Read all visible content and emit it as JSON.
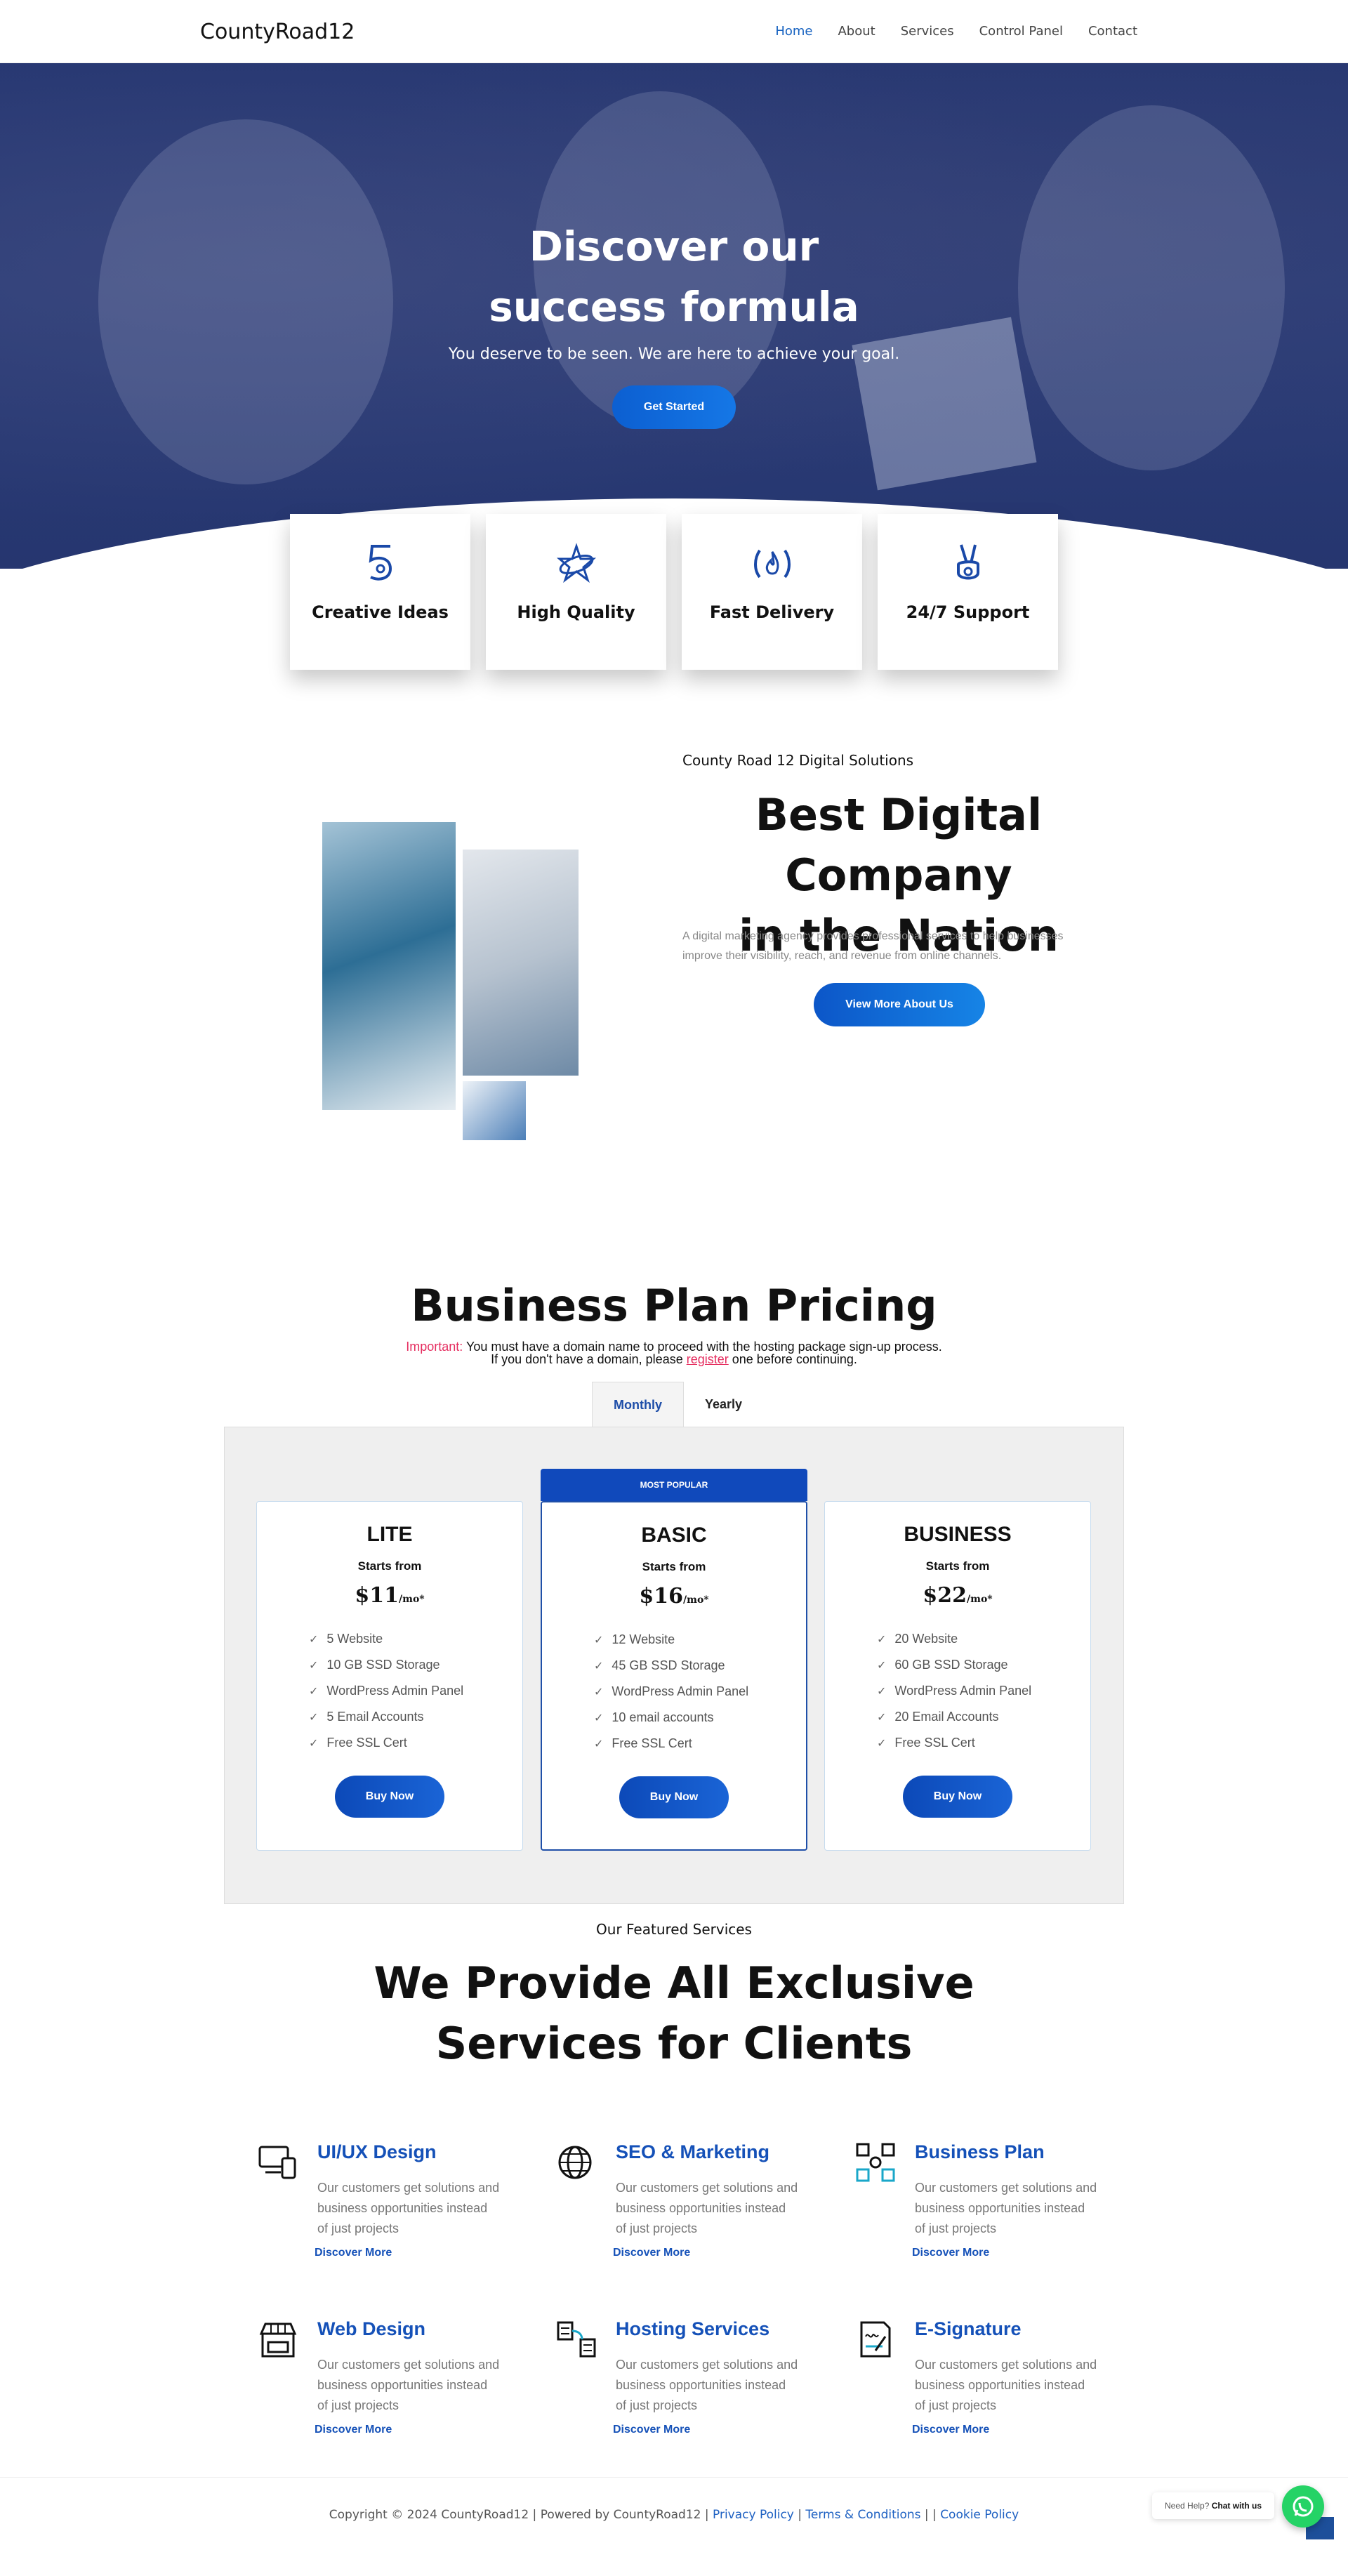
{
  "nav": {
    "logo": "CountyRoad12",
    "items": [
      "Home",
      "About",
      "Services",
      "Control Panel",
      "Contact"
    ],
    "active": "Home"
  },
  "hero": {
    "title_line1": "Discover our",
    "title_line2": "success formula",
    "subtitle": "You deserve to be seen. We are here to achieve your goal.",
    "cta": "Get Started"
  },
  "features": [
    {
      "label": "Creative Ideas",
      "icon": "number-5-icon"
    },
    {
      "label": "High Quality",
      "icon": "star-orbit-icon"
    },
    {
      "label": "Fast Delivery",
      "icon": "flame-icon"
    },
    {
      "label": "24/7 Support",
      "icon": "victory-hand-icon"
    }
  ],
  "about": {
    "eyebrow": "County Road 12 Digital Solutions",
    "title_line1": "Best Digital Company",
    "title_line2": "in the Nation",
    "text": "A digital marketing agency provides professional services to help businesses improve their visibility, reach, and revenue from online channels.",
    "cta": "View More About Us"
  },
  "pricing": {
    "title": "Business Plan Pricing",
    "note_important": "Important:",
    "note_rest": " You must have a domain name to proceed with the hosting package sign-up process.",
    "note_line2_a": "If you don't have a domain, please ",
    "note_register": "register",
    "note_line2_b": " one before continuing.",
    "tabs": [
      "Monthly",
      "Yearly"
    ],
    "active_tab": "Monthly",
    "popular_badge": "MOST POPULAR",
    "starts_label": "Starts from",
    "per": "/mo*",
    "plans": [
      {
        "name": "LITE",
        "price": "$11",
        "features": [
          "5 Website",
          "10 GB SSD Storage",
          "WordPress Admin Panel",
          "5 Email Accounts",
          "Free SSL Cert"
        ],
        "cta": "Buy Now"
      },
      {
        "name": "BASIC",
        "price": "$16",
        "features": [
          "12 Website",
          "45 GB SSD Storage",
          "WordPress Admin Panel",
          "10 email accounts",
          "Free SSL Cert"
        ],
        "cta": "Buy Now"
      },
      {
        "name": "BUSINESS",
        "price": "$22",
        "features": [
          "20 Website",
          "60 GB SSD Storage",
          "WordPress Admin Panel",
          "20 Email Accounts",
          "Free SSL Cert"
        ],
        "cta": "Buy Now"
      }
    ]
  },
  "services": {
    "eyebrow": "Our Featured Services",
    "title_line1": "We Provide All Exclusive",
    "title_line2": "Services for Clients",
    "description": "Our customers get solutions and business opportunities instead of just projects",
    "more": "Discover More",
    "items": [
      {
        "name": "UI/UX Design",
        "icon": "devices-icon"
      },
      {
        "name": "SEO & Marketing",
        "icon": "globe-icon"
      },
      {
        "name": "Business Plan",
        "icon": "flowchart-icon"
      },
      {
        "name": "Web Design",
        "icon": "storefront-icon"
      },
      {
        "name": "Hosting Services",
        "icon": "server-icon"
      },
      {
        "name": "E-Signature",
        "icon": "signature-icon"
      }
    ]
  },
  "footer": {
    "copyright": "Copyright © 2024 CountyRoad12 | Powered by CountyRoad12 | ",
    "privacy": "Privacy Policy",
    "sep1": " | ",
    "terms": "Terms & Conditions",
    "sep2": " | | ",
    "cookie": "Cookie Policy"
  },
  "help_widget": {
    "text": "Need Help? ",
    "bold": "Chat with us"
  },
  "colors": {
    "primary": "#1551b8",
    "hero_overlay": "#253671",
    "important": "#e52d5f",
    "whatsapp": "#25d366"
  }
}
